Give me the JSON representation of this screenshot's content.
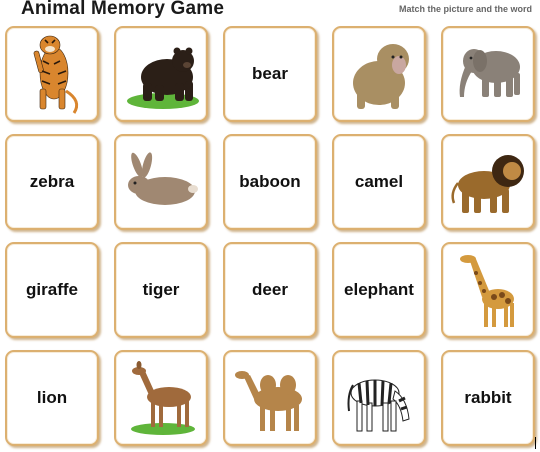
{
  "header": {
    "title": "Animal Memory Game",
    "subtitle": "Match the picture and the word"
  },
  "cards": [
    {
      "kind": "picture",
      "icon": "tiger-icon"
    },
    {
      "kind": "picture",
      "icon": "bear-icon"
    },
    {
      "kind": "word",
      "word": "bear"
    },
    {
      "kind": "picture",
      "icon": "baboon-icon"
    },
    {
      "kind": "picture",
      "icon": "elephant-icon"
    },
    {
      "kind": "word",
      "word": "zebra"
    },
    {
      "kind": "picture",
      "icon": "rabbit-icon"
    },
    {
      "kind": "word",
      "word": "baboon"
    },
    {
      "kind": "word",
      "word": "camel"
    },
    {
      "kind": "picture",
      "icon": "lion-icon"
    },
    {
      "kind": "word",
      "word": "giraffe"
    },
    {
      "kind": "word",
      "word": "tiger"
    },
    {
      "kind": "word",
      "word": "deer"
    },
    {
      "kind": "word",
      "word": "elephant"
    },
    {
      "kind": "picture",
      "icon": "giraffe-icon"
    },
    {
      "kind": "word",
      "word": "lion"
    },
    {
      "kind": "picture",
      "icon": "deer-icon"
    },
    {
      "kind": "picture",
      "icon": "camel-icon"
    },
    {
      "kind": "picture",
      "icon": "zebra-icon"
    },
    {
      "kind": "word",
      "word": "rabbit"
    }
  ],
  "colors": {
    "card_border": "#dcb070",
    "tiger": "#d9862e",
    "bear": "#2b1f17",
    "grass": "#5fb53a",
    "baboon": "#a98f63",
    "elephant": "#8a8178",
    "rabbit": "#a08872",
    "lion": "#9a6a2c",
    "giraffe": "#d49a3e",
    "deer": "#a06a3c",
    "camel": "#b5854a",
    "zebra": "#222222"
  }
}
